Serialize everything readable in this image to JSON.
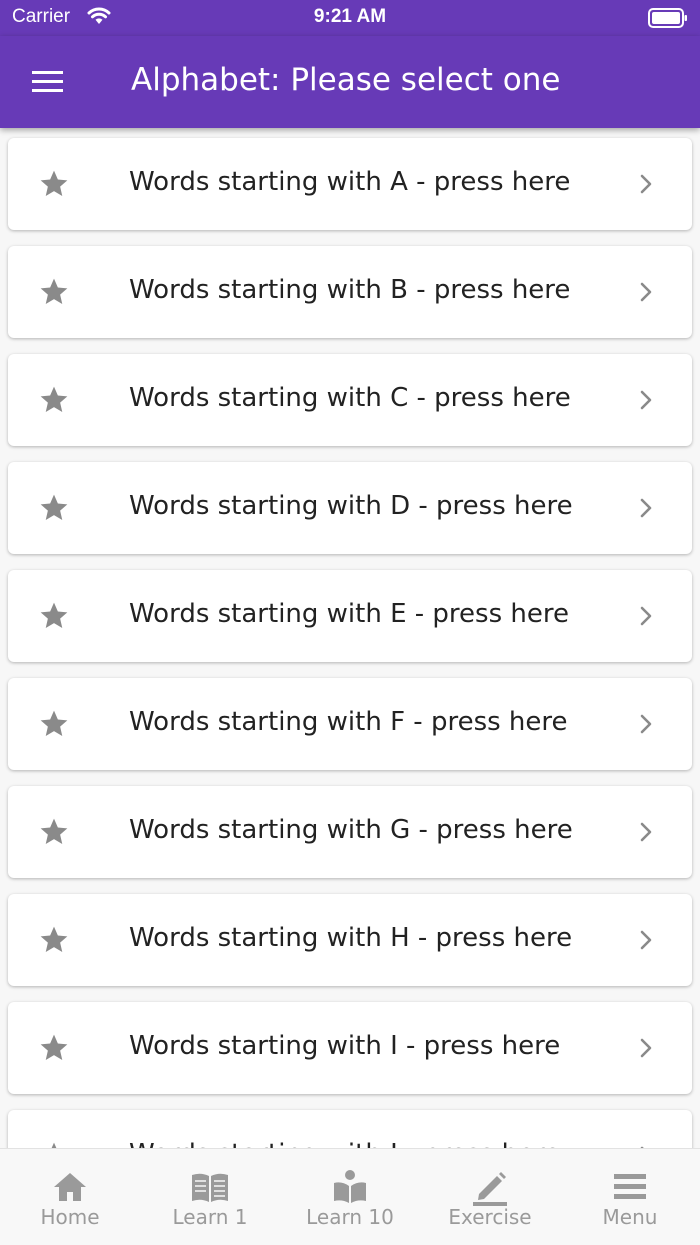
{
  "status_bar": {
    "carrier": "Carrier",
    "time": "9:21 AM"
  },
  "app_bar": {
    "title": "Alphabet: Please select one",
    "menu_icon": "hamburger-icon"
  },
  "colors": {
    "primary": "#673ab7",
    "icon_gray": "#8a8a8a",
    "tab_gray": "#9a9a9a"
  },
  "list": {
    "items": [
      {
        "label": "Words starting with A - press here"
      },
      {
        "label": "Words starting with B - press here"
      },
      {
        "label": "Words starting with C - press here"
      },
      {
        "label": "Words starting with D - press here"
      },
      {
        "label": "Words starting with E - press here"
      },
      {
        "label": "Words starting with F - press here"
      },
      {
        "label": "Words starting with G - press here"
      },
      {
        "label": "Words starting with H - press here"
      },
      {
        "label": "Words starting with I - press here"
      },
      {
        "label": "Words starting with J - press here"
      }
    ]
  },
  "tab_bar": {
    "tabs": [
      {
        "label": "Home",
        "icon": "home-icon"
      },
      {
        "label": "Learn 1",
        "icon": "book-icon"
      },
      {
        "label": "Learn 10",
        "icon": "reader-icon"
      },
      {
        "label": "Exercise",
        "icon": "pencil-icon"
      },
      {
        "label": "Menu",
        "icon": "menu-icon"
      }
    ]
  }
}
